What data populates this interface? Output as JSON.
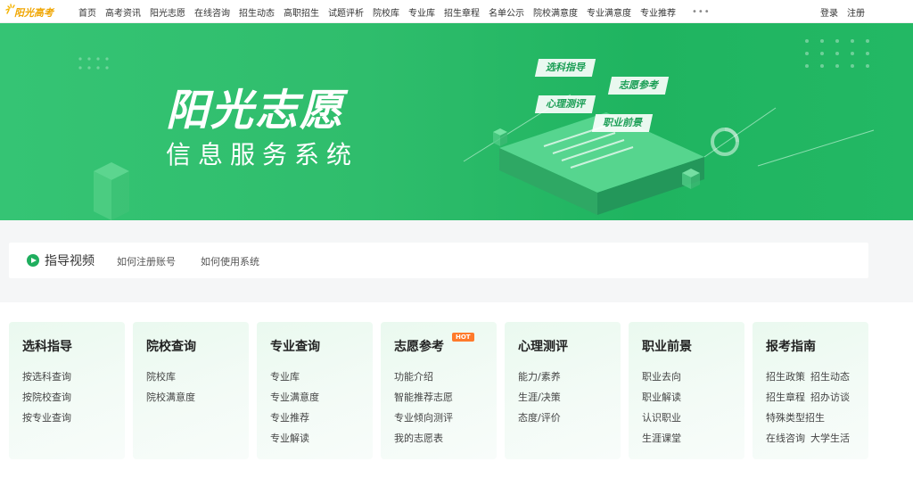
{
  "logo": {
    "text": "阳光高考"
  },
  "nav": [
    "首页",
    "高考资讯",
    "阳光志愿",
    "在线咨询",
    "招生动态",
    "高职招生",
    "试题评析",
    "院校库",
    "专业库",
    "招生章程",
    "名单公示",
    "院校满意度",
    "专业满意度",
    "专业推荐"
  ],
  "nav_more": "•••",
  "auth": {
    "login": "登录",
    "register": "注册"
  },
  "banner": {
    "title": "阳光志愿",
    "subtitle": "信息服务系统",
    "tags": [
      "选科指导",
      "志愿参考",
      "心理测评",
      "职业前景"
    ]
  },
  "guide": {
    "title": "指导视频",
    "links": [
      "如何注册账号",
      "如何使用系统"
    ]
  },
  "cards": [
    {
      "title": "选科指导",
      "links": [
        "按选科查询",
        "按院校查询",
        "按专业查询"
      ]
    },
    {
      "title": "院校查询",
      "links": [
        "院校库",
        "院校满意度"
      ]
    },
    {
      "title": "专业查询",
      "links": [
        "专业库",
        "专业满意度",
        "专业推荐",
        "专业解读"
      ]
    },
    {
      "title": "志愿参考",
      "badge": "HOT",
      "links": [
        "功能介绍",
        "智能推荐志愿",
        "专业倾向测评",
        "我的志愿表"
      ]
    },
    {
      "title": "心理测评",
      "links": [
        "能力/素养",
        "生涯/决策",
        "态度/评价"
      ]
    },
    {
      "title": "职业前景",
      "links": [
        "职业去向",
        "职业解读",
        "认识职业",
        "生涯课堂"
      ]
    },
    {
      "title": "报考指南",
      "rows": [
        [
          "招生政策",
          "招生动态"
        ],
        [
          "招生章程",
          "招办访谈"
        ],
        [
          "特殊类型招生"
        ],
        [
          "在线咨询",
          "大学生活"
        ]
      ]
    }
  ],
  "colors": {
    "brand_green": "#1fae5e",
    "hot": "#ff7a2b",
    "logo": "#f0a500"
  }
}
